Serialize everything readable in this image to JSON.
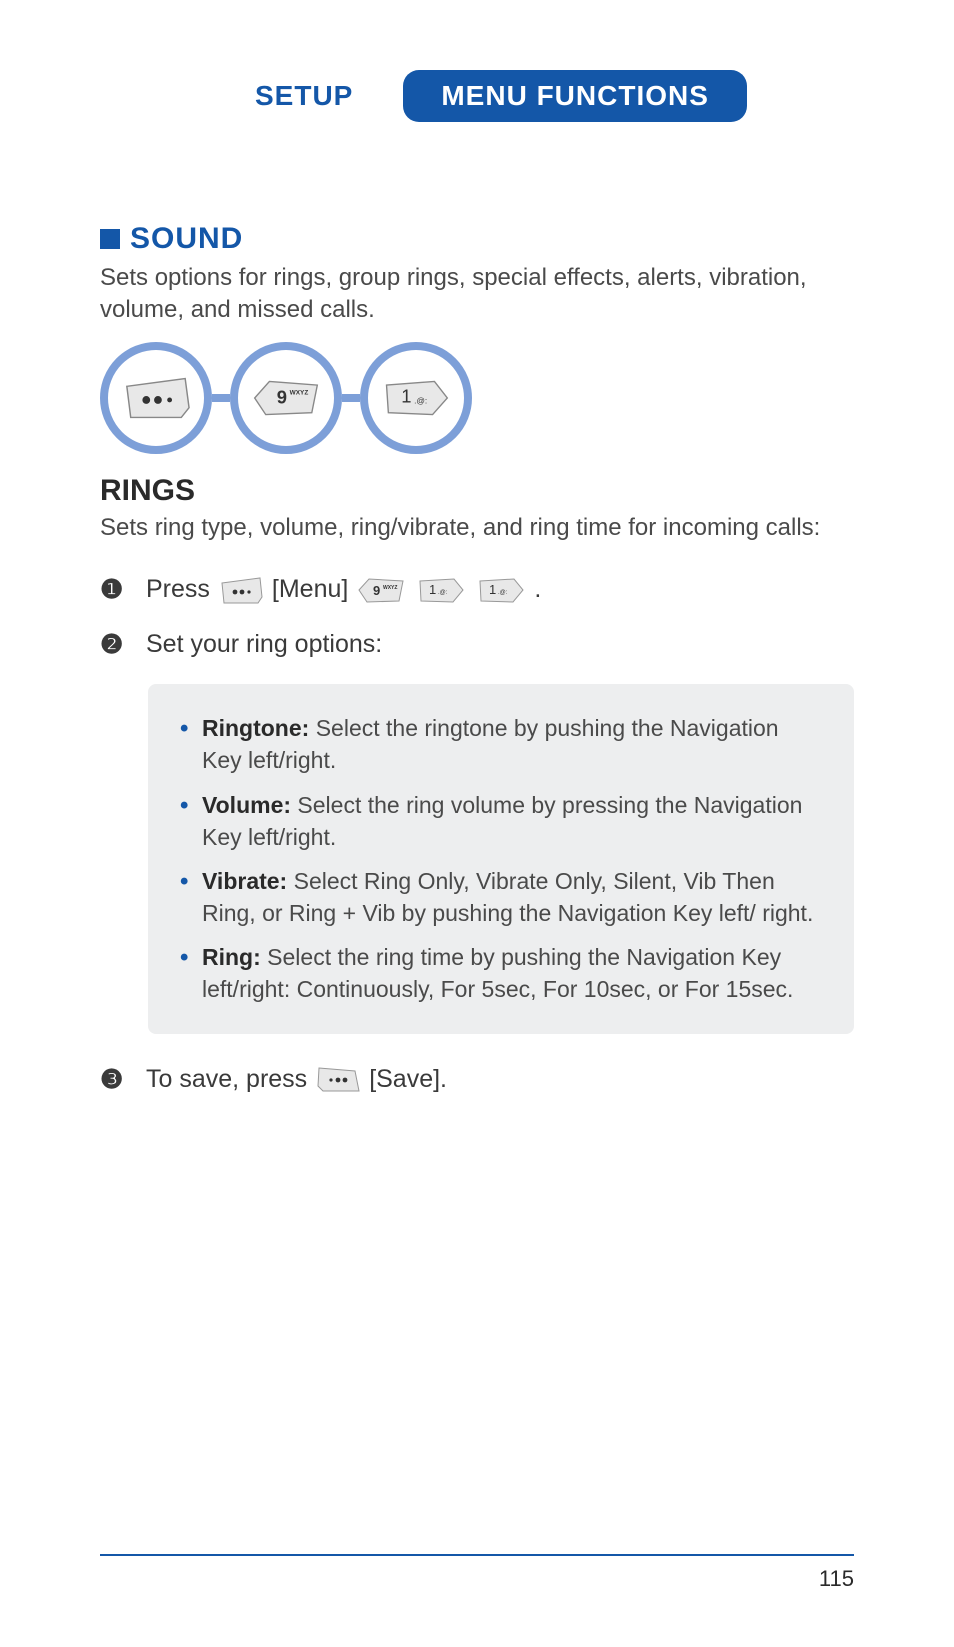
{
  "header": {
    "setup": "SETUP",
    "pill": "MENU FUNCTIONS"
  },
  "section": {
    "title": "SOUND",
    "desc": "Sets options for rings, group rings, special effects, alerts, vibration, volume, and missed calls."
  },
  "keys": {
    "menu": "•••",
    "nine_digit": "9",
    "nine_letters": "WXYZ",
    "one_digit": "1",
    "one_symbols": ".@:"
  },
  "subsection": {
    "title": "RINGS",
    "desc": "Sets ring type, volume, ring/vibrate, and ring time for incoming calls:"
  },
  "steps": {
    "s1_num": "❶",
    "s1_press": "Press",
    "s1_menu_label": "[Menu]",
    "s1_period": ".",
    "s2_num": "❷",
    "s2_text": "Set your ring options:",
    "s3_num": "❸",
    "s3_prefix": "To save, press",
    "s3_label": "[Save]."
  },
  "options": {
    "ringtone_label": "Ringtone:",
    "ringtone_text": " Select the ringtone by pushing the Navigation Key left/right.",
    "volume_label": "Volume:",
    "volume_text": " Select the ring volume by pressing the Navigation Key left/right.",
    "vibrate_label": "Vibrate:",
    "vibrate_text": " Select Ring Only, Vibrate Only, Silent, Vib Then Ring, or Ring + Vib by pushing the Navigation Key left/ right.",
    "ring_label": "Ring:",
    "ring_text": " Select the ring time by pushing the Navigation Key left/right: Continuously, For 5sec, For 10sec, or For 15sec."
  },
  "page_number": "115"
}
